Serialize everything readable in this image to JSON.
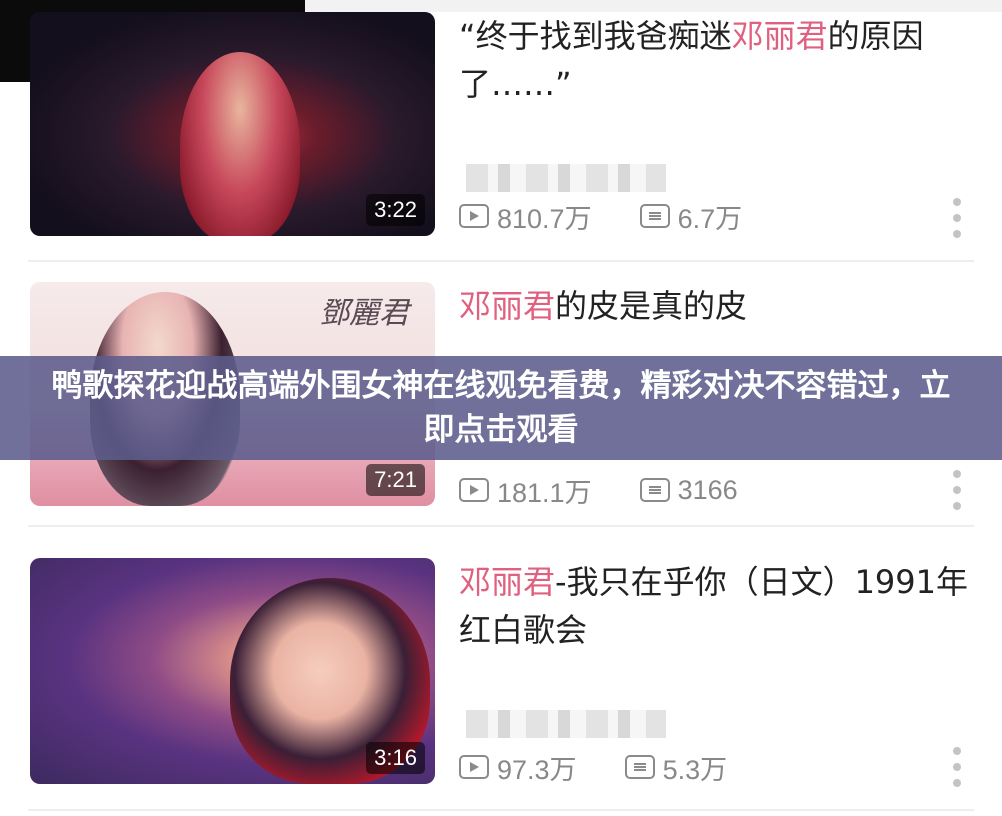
{
  "videos": [
    {
      "title_pre": "“终于找到我爸痴迷",
      "title_hl": "邓丽君",
      "title_post": "的原因了……”",
      "duration": "3:22",
      "views": "810.7万",
      "comments": "6.7万"
    },
    {
      "title_pre": "",
      "title_hl": "邓丽君",
      "title_post": "的皮是真的皮",
      "duration": "7:21",
      "views": "181.1万",
      "comments": "3166",
      "thumb_logo": "鄧麗君"
    },
    {
      "title_pre": "",
      "title_hl": "邓丽君",
      "title_post": "-我只在乎你（日文）1991年红白歌会",
      "duration": "3:16",
      "views": "97.3万",
      "comments": "5.3万"
    }
  ],
  "banner": {
    "text": "鸭歌探花迎战高端外围女神在线观免看费，精彩对决不容错过，立即点击观看"
  },
  "colors": {
    "highlight": "#e0607f",
    "banner_bg": "#5c5c8c",
    "stat_text": "#888888"
  },
  "icons": {
    "views": "play-icon",
    "comments": "danmaku-icon",
    "more": "more-vertical-icon"
  }
}
